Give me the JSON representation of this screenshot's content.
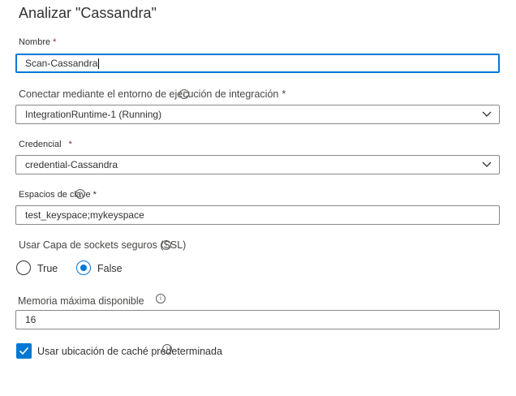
{
  "dialog": {
    "title": "Analizar \"Cassandra\""
  },
  "name_field": {
    "label": "Nombre",
    "required_mark": "*",
    "value": "Scan-Cassandra"
  },
  "runtime_field": {
    "label": "Conectar mediante el entorno de ejecución de integración",
    "required_mark": "*",
    "info_icon": "info-icon",
    "value": "IntegrationRuntime-1 (Running)"
  },
  "credential_field": {
    "label": "Credencial",
    "required_mark": "*",
    "value": "credential-Cassandra"
  },
  "keyspaces_field": {
    "label": "Espacios de clave",
    "required_mark": "*",
    "info_icon": "info-icon",
    "value": "test_keyspace;mykeyspace"
  },
  "ssl_field": {
    "label": "Usar Capa de sockets seguros (SSL)",
    "info_icon": "info-icon",
    "options": [
      "True",
      "False"
    ],
    "selected": "False"
  },
  "memory_field": {
    "label": "Memoria máxima disponible",
    "info_icon": "info-icon",
    "value": "16"
  },
  "cache_checkbox": {
    "label": "Usar ubicación de caché predeterminada",
    "checked": true,
    "info_icon": "info-icon"
  },
  "colors": {
    "accent": "#0078d4",
    "required": "#a4262c",
    "border": "#8a8886",
    "text": "#323130"
  }
}
